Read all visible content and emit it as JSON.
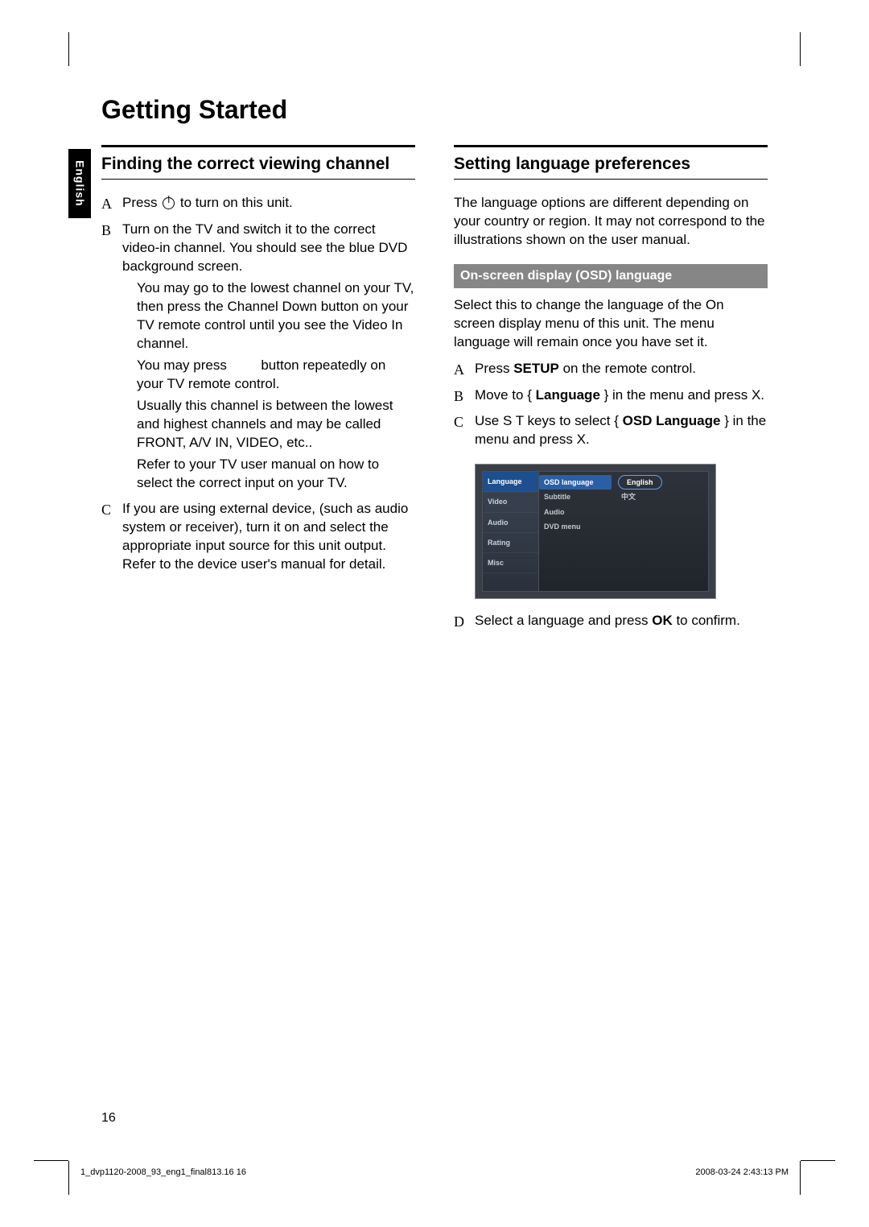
{
  "language_tab": "English",
  "page_title": "Getting Started",
  "left": {
    "heading": "Finding the correct viewing channel",
    "steps": {
      "a_marker": "A",
      "a_pre": "Press ",
      "a_post": " to turn on this unit.",
      "b_marker": "B",
      "b": "Turn on the TV and switch it to the correct video-in channel. You should see the blue DVD background screen.",
      "b_sub1": "You may go to the lowest channel on your TV, then press the Channel Down button on your TV remote control until you see the Video In channel.",
      "b_sub2_pre": "You may press ",
      "b_sub2_post": " button repeatedly on your TV remote control.",
      "b_sub3": "Usually this channel is between the lowest and highest channels and may be called FRONT, A/V IN, VIDEO, etc..",
      "b_sub4": "Refer to your TV user manual on how to select the correct input on your TV.",
      "c_marker": "C",
      "c": "If you are using external device, (such as audio system or receiver), turn it on and select the appropriate input source for this unit output. Refer to the device user's manual for detail."
    }
  },
  "right": {
    "heading": "Setting language preferences",
    "intro": "The language options are different depending on your country or region. It may not correspond to the illustrations shown on the user manual.",
    "osd_bar": "On-screen display (OSD) language",
    "osd_intro": "Select this to change the language of the On screen display menu of this unit. The menu language will remain once you have set it.",
    "steps": {
      "a_marker": "A",
      "a_pre": "Press ",
      "a_bold": "SETUP",
      "a_post": " on the remote control.",
      "b_marker": "B",
      "b_pre": "Move to { ",
      "b_bold": "Language",
      "b_post": " } in the menu and press  X.",
      "c_marker": "C",
      "c_pre": "Use  S T  keys to select { ",
      "c_bold": "OSD Language",
      "c_post": " } in the menu and press  X.",
      "d_marker": "D",
      "d_pre": "Select a language and press ",
      "d_bold": "OK",
      "d_post": " to confirm."
    },
    "menu": {
      "left_items": [
        "Language",
        "Video",
        "Audio",
        "Rating",
        "Misc"
      ],
      "mid_items": [
        "OSD language",
        "Subtitle",
        "Audio",
        "DVD menu"
      ],
      "right_items": [
        "English",
        "中文"
      ]
    }
  },
  "page_number": "16",
  "footer_left": "1_dvp1120-2008_93_eng1_final813.16   16",
  "footer_right": "2008-03-24   2:43:13 PM"
}
